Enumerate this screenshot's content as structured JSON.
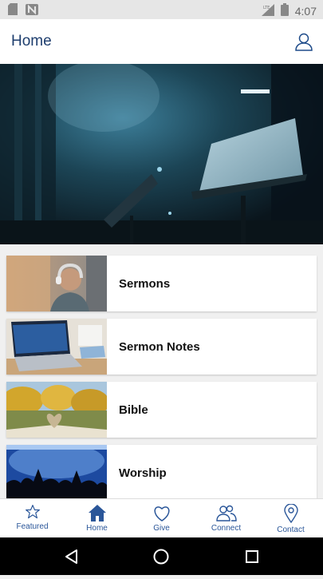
{
  "status": {
    "time": "4:07",
    "lte": "LTE"
  },
  "app_bar": {
    "title": "Home"
  },
  "items": [
    {
      "label": "Sermons"
    },
    {
      "label": "Sermon Notes"
    },
    {
      "label": "Bible"
    },
    {
      "label": "Worship"
    }
  ],
  "tabs": [
    {
      "label": "Featured",
      "icon": "star-icon"
    },
    {
      "label": "Home",
      "icon": "home-icon"
    },
    {
      "label": "Give",
      "icon": "heart-icon"
    },
    {
      "label": "Connect",
      "icon": "people-icon"
    },
    {
      "label": "Contact",
      "icon": "map-pin-icon"
    }
  ],
  "colors": {
    "accent": "#1f4c8a",
    "title": "#1e3e6e"
  }
}
